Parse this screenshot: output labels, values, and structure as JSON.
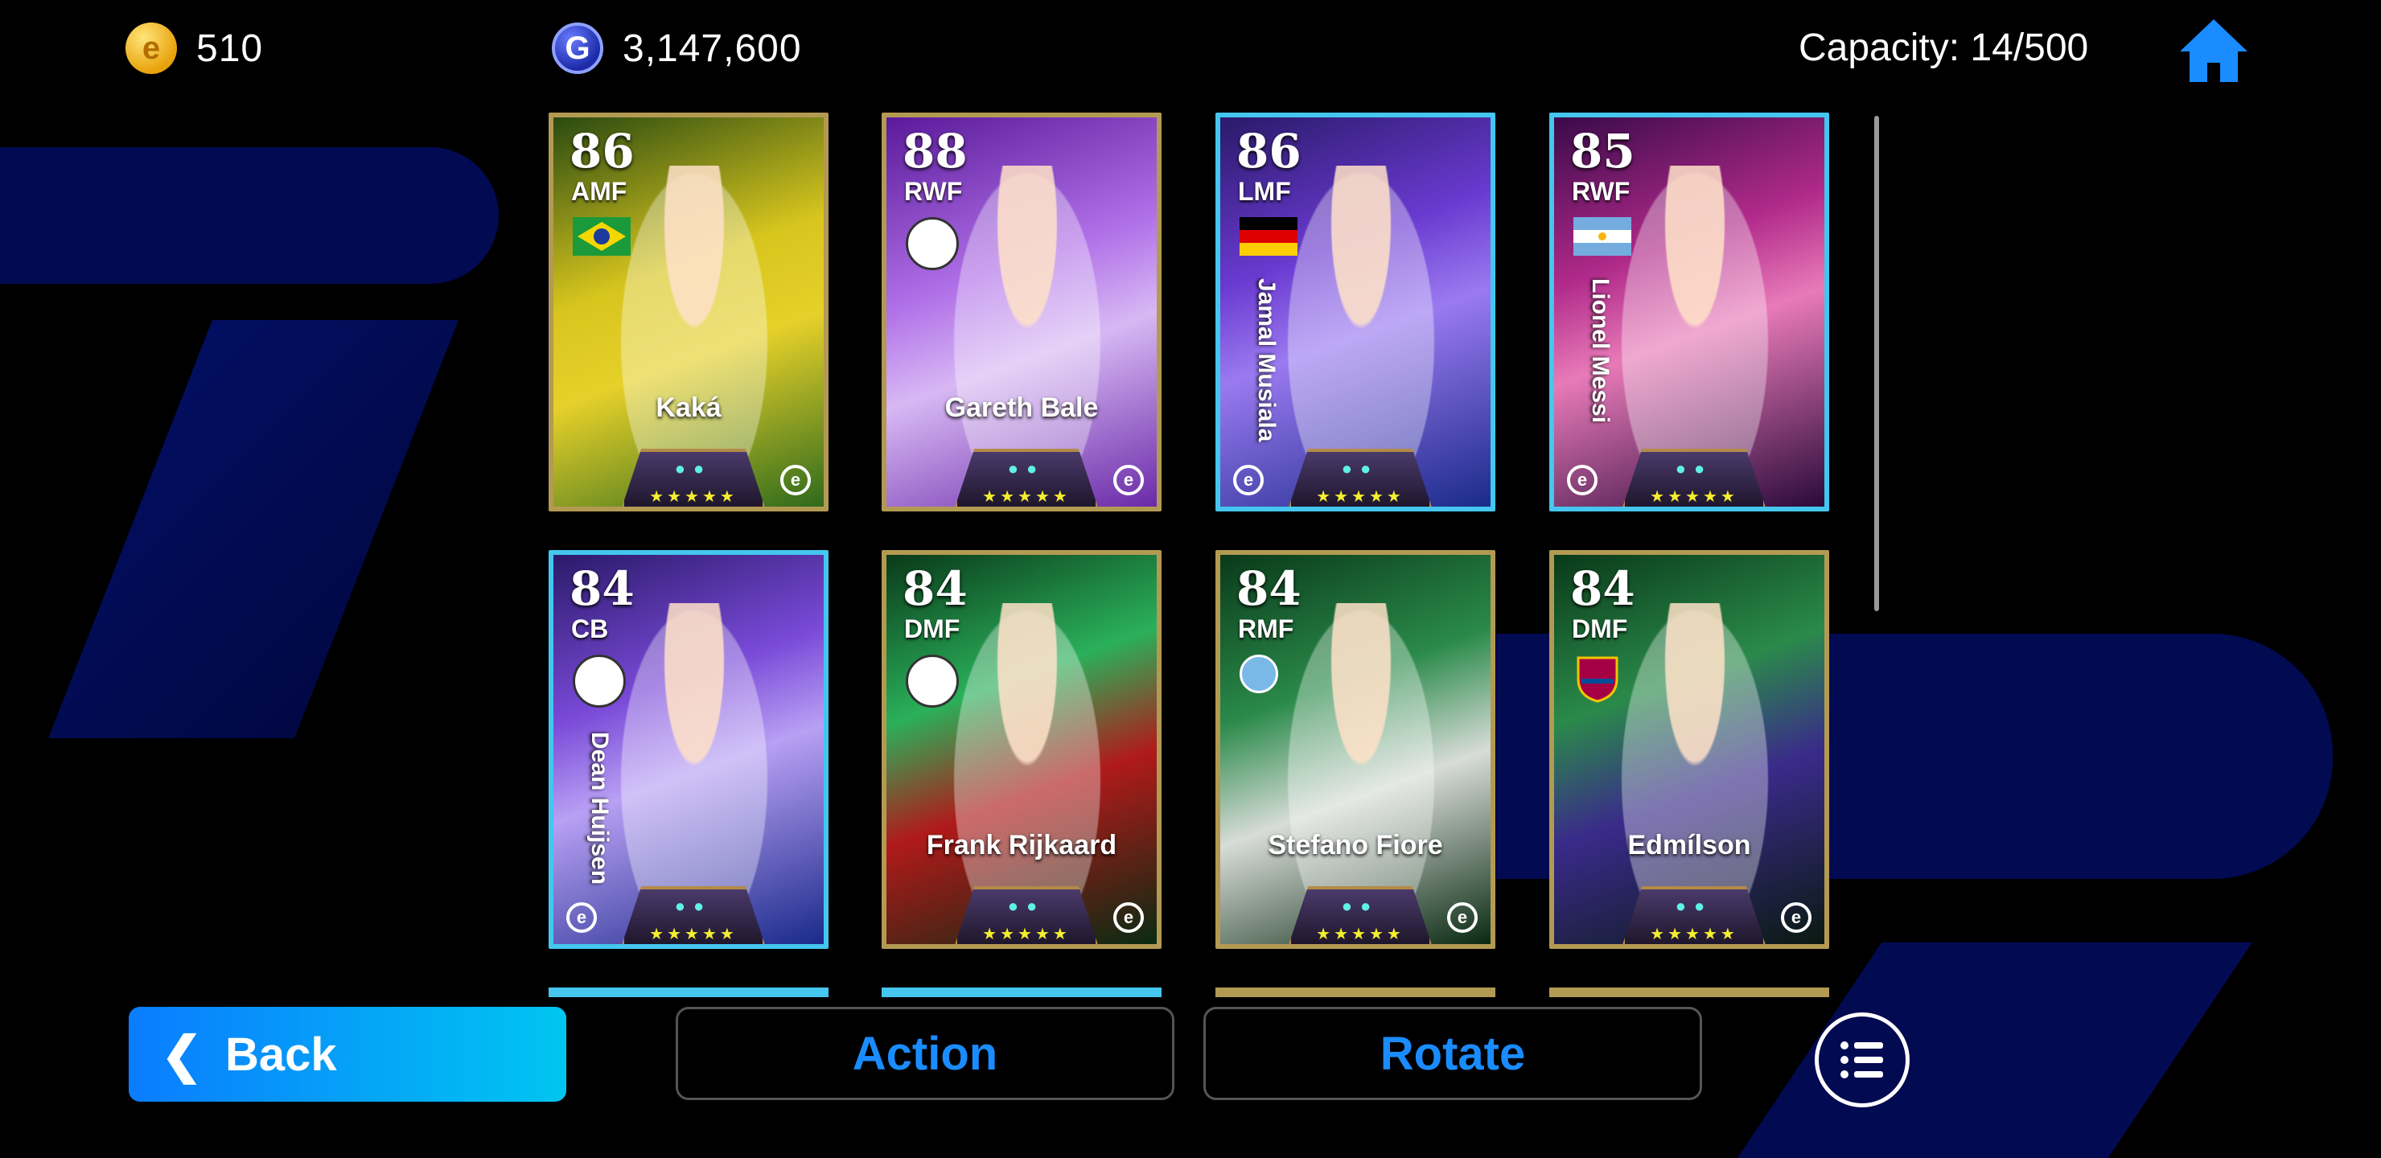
{
  "header": {
    "ecoins": "510",
    "gp": "3,147,600",
    "capacity": "Capacity: 14/500"
  },
  "cards": [
    {
      "rating": "86",
      "position": "AMF",
      "name": "Kaká",
      "badge": "brazil-flag-icon",
      "name_vertical": false
    },
    {
      "rating": "88",
      "position": "RWF",
      "name": "Gareth Bale",
      "badge": "club-crest-icon",
      "name_vertical": false
    },
    {
      "rating": "86",
      "position": "LMF",
      "name": "Jamal Musiala",
      "badge": "germany-flag-icon",
      "name_vertical": true
    },
    {
      "rating": "85",
      "position": "RWF",
      "name": "Lionel Messi",
      "badge": "argentina-flag-icon",
      "name_vertical": true
    },
    {
      "rating": "84",
      "position": "CB",
      "name": "Dean Huijsen",
      "badge": "club-crest-icon",
      "name_vertical": true
    },
    {
      "rating": "84",
      "position": "DMF",
      "name": "Frank Rijkaard",
      "badge": "club-crest-icon",
      "name_vertical": false
    },
    {
      "rating": "84",
      "position": "RMF",
      "name": "Stefano Fiore",
      "badge": "lazio-crest-icon",
      "name_vertical": false
    },
    {
      "rating": "84",
      "position": "DMF",
      "name": "Edmílson",
      "badge": "barcelona-crest-icon",
      "name_vertical": false
    }
  ],
  "card_stars": "★★★★★",
  "footer": {
    "back_label": "Back",
    "action_label": "Action",
    "rotate_label": "Rotate"
  },
  "icons": [
    "ecoin-icon",
    "gp-coin-icon",
    "home-icon",
    "chevron-left-icon",
    "list-menu-icon"
  ],
  "colors": {
    "accent": "#1a8cff",
    "back_gradient_start": "#0a7cff",
    "back_gradient_end": "#00c6f0",
    "card_gold_border": "#b39a52",
    "card_blue_border": "#44c6ee"
  }
}
